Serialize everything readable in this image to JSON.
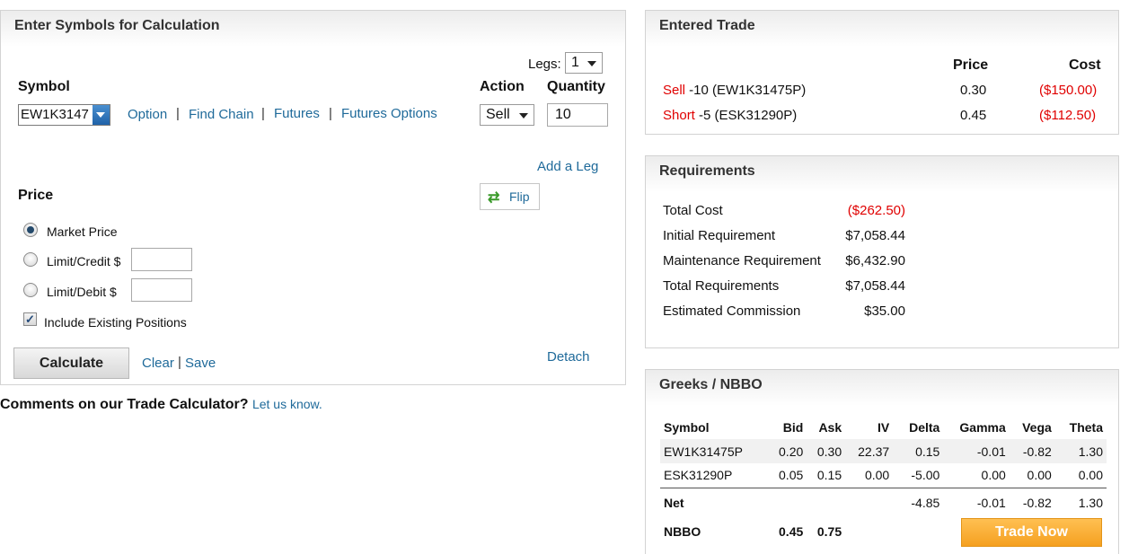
{
  "calc": {
    "title": "Enter Symbols for Calculation",
    "legs_label": "Legs:",
    "legs_value": "1",
    "symbol_label": "Symbol",
    "action_label": "Action",
    "quantity_label": "Quantity",
    "symbol_value": "EW1K3147",
    "links": [
      "Option",
      "Find Chain",
      "Futures",
      "Futures Options"
    ],
    "separator": "|",
    "action_value": "Sell",
    "quantity_value": "10",
    "add_leg": "Add a Leg",
    "price_label": "Price",
    "flip_label": "Flip",
    "market_price": "Market Price",
    "limit_credit": "Limit/Credit $",
    "limit_debit": "Limit/Debit $",
    "include_existing": "Include Existing Positions",
    "calculate": "Calculate",
    "clear": "Clear",
    "save": "Save",
    "detach": "Detach"
  },
  "comments": {
    "text": "Comments on our Trade Calculator?",
    "link": "Let us know."
  },
  "entered": {
    "title": "Entered Trade",
    "price_header": "Price",
    "cost_header": "Cost",
    "rows": [
      {
        "action": "Sell",
        "desc": " -10 (EW1K31475P)",
        "price": "0.30",
        "cost": "($150.00)"
      },
      {
        "action": "Short",
        "desc": " -5 (ESK31290P)",
        "price": "0.45",
        "cost": "($112.50)"
      }
    ]
  },
  "requirements": {
    "title": "Requirements",
    "rows": [
      {
        "label": "Total Cost",
        "value": "($262.50)"
      },
      {
        "label": "Initial Requirement",
        "value": "$7,058.44"
      },
      {
        "label": "Maintenance Requirement",
        "value": "$6,432.90"
      },
      {
        "label": "Total Requirements",
        "value": "$7,058.44"
      },
      {
        "label": "Estimated Commission",
        "value": "$35.00"
      }
    ]
  },
  "greeks": {
    "title": "Greeks / NBBO",
    "headers": [
      "Symbol",
      "Bid",
      "Ask",
      "IV",
      "Delta",
      "Gamma",
      "Vega",
      "Theta"
    ],
    "rows": [
      [
        "EW1K31475P",
        "0.20",
        "0.30",
        "22.37",
        "0.15",
        "-0.01",
        "-0.82",
        "1.30"
      ],
      [
        "ESK31290P",
        "0.05",
        "0.15",
        "0.00",
        "-5.00",
        "0.00",
        "0.00",
        "0.00"
      ]
    ],
    "net": [
      "Net",
      "",
      "",
      "",
      "-4.85",
      "-0.01",
      "-0.82",
      "1.30"
    ],
    "nbbo": [
      "NBBO",
      "0.45",
      "0.75"
    ],
    "trade_now": "Trade Now"
  },
  "colors": {
    "accent_link": "#1f6a9a",
    "negative": "#e00000",
    "trade_button": "#f7a52a"
  }
}
